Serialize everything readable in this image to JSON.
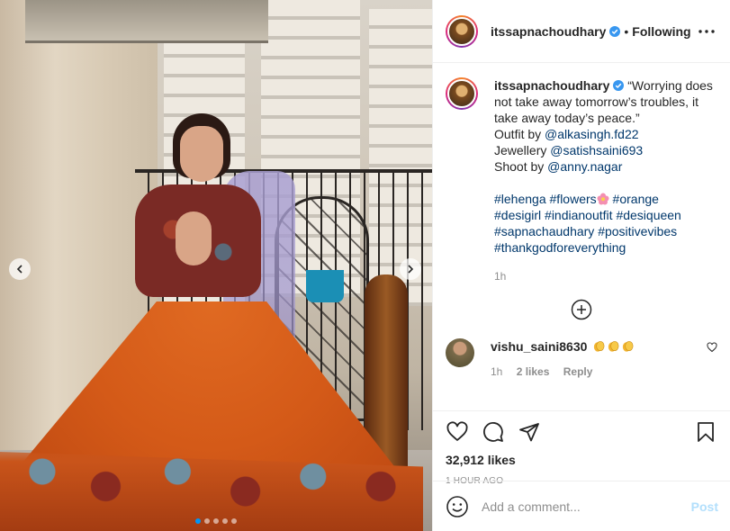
{
  "post": {
    "username": "itssapnachoudhary",
    "follow_separator": "•",
    "follow_state": "Following",
    "caption": {
      "quote": "“Worrying does not take away tomorrow’s troubles, it take away today’s peace.”",
      "outfit_prefix": "Outfit by ",
      "outfit_handle": "@alkasingh.fd22",
      "jewellery_prefix": "Jewellery ",
      "jewellery_handle": "@satishsaini693",
      "shoot_prefix": "Shoot by ",
      "shoot_handle": "@anny.nagar",
      "tags_line1": [
        "#lehenga",
        "#flowers",
        "#orange"
      ],
      "tags_line2": [
        "#desigirl",
        "#indianoutfit",
        "#desiqueen"
      ],
      "tags_line3": [
        "#sapnachaudhary",
        "#positivevibes"
      ],
      "tags_line4": [
        "#thankgodforeverything"
      ],
      "time": "1h"
    },
    "comments": [
      {
        "username": "vishu_saini8630",
        "emoji": [
          "clap",
          "clap",
          "clap"
        ],
        "time": "1h",
        "likes": "2 likes",
        "reply": "Reply"
      }
    ],
    "likes": "32,912 likes",
    "posted": "1 HOUR AGO",
    "add_comment_placeholder": "Add a comment...",
    "post_label": "Post"
  },
  "media": {
    "total_slides": 5,
    "active_slide": 1
  },
  "icons": {
    "more": "more-horizontal-icon",
    "verified": "verified-badge-icon",
    "load_more": "plus-circle-icon",
    "like": "heart-icon",
    "comment": "comment-icon",
    "share": "paper-plane-icon",
    "save": "bookmark-icon",
    "emoji": "smiley-icon",
    "prev": "chevron-left-icon",
    "next": "chevron-right-icon"
  },
  "colors": {
    "link": "#00376b",
    "verified": "#3897f0",
    "muted": "#8e8e8e",
    "post_disabled": "#b2dffc",
    "active_dot": "#0095f6"
  }
}
